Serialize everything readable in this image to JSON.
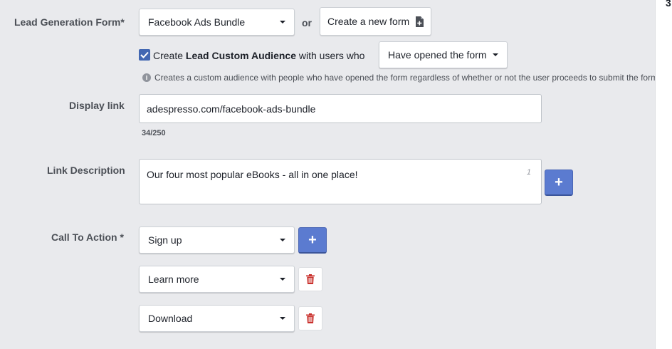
{
  "lead_form": {
    "label": "Lead Generation Form*",
    "selected": "Facebook Ads Bundle",
    "or_text": "or",
    "create_button": "Create a new form"
  },
  "audience": {
    "checked": true,
    "text_before": "Create ",
    "text_bold": "Lead Custom Audience",
    "text_after": " with users who",
    "condition_selected": "Have opened the form",
    "info_text": "Creates a custom audience with people who have opened the form regardless of whether or not the user proceeds to submit the form"
  },
  "display_link": {
    "label": "Display link",
    "value": "adespresso.com/facebook-ads-bundle",
    "counter": "34/250"
  },
  "link_description": {
    "label": "Link Description",
    "value": "Our four most popular eBooks - all in one place!",
    "index": "1",
    "add_label": "+"
  },
  "call_to_action": {
    "label": "Call To Action *",
    "add_label": "+",
    "options": [
      "Sign up",
      "Learn more",
      "Download"
    ]
  },
  "right_edge": {
    "text": "3"
  },
  "colors": {
    "accent": "#5b7bd0",
    "checkbox": "#4267b2",
    "trash": "#c9302c",
    "background": "#e9eaed"
  }
}
